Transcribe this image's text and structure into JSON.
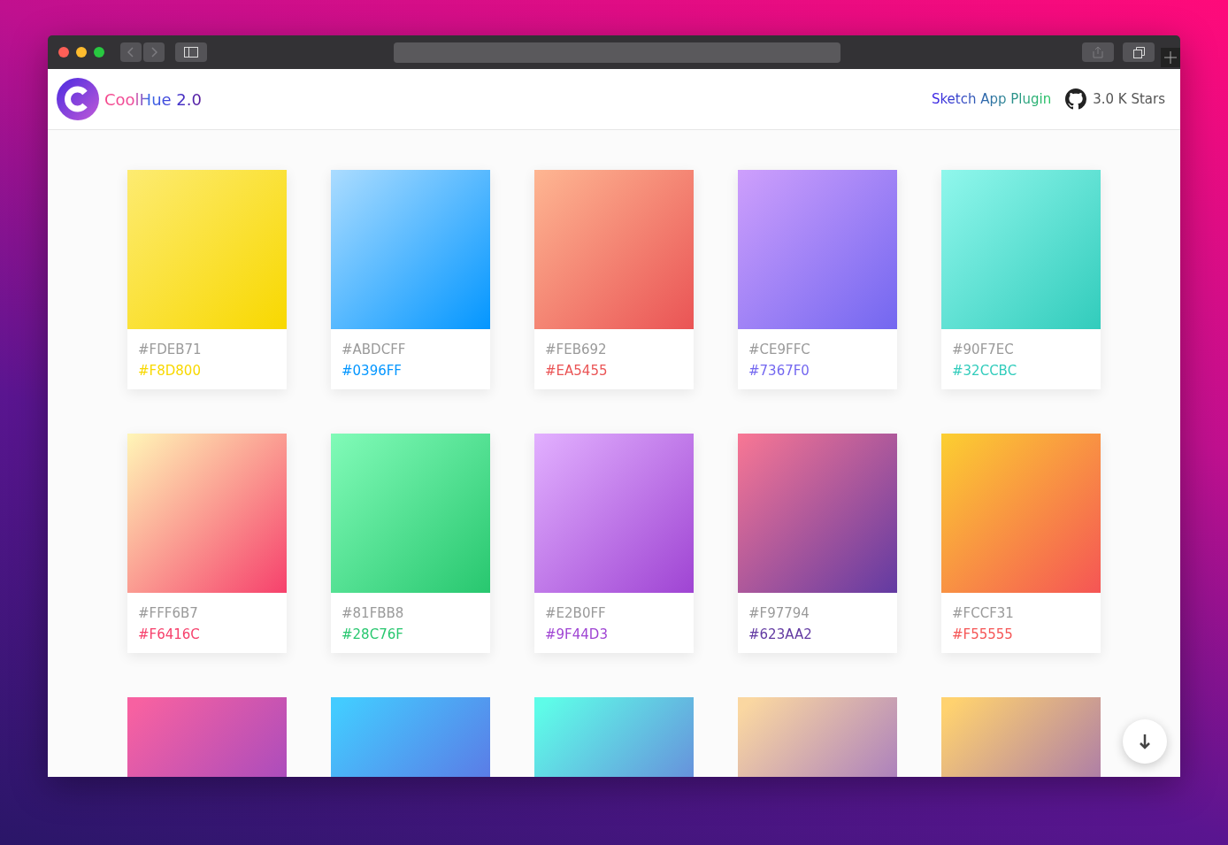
{
  "header": {
    "title": "CoolHue 2.0",
    "links": [
      {
        "kind": "plugin",
        "label": "Sketch App Plugin"
      },
      {
        "kind": "github",
        "label": "3.0 K Stars"
      }
    ]
  },
  "cards": [
    {
      "kind": "full",
      "start": "#FDEB71",
      "end": "#F8D800"
    },
    {
      "kind": "full",
      "start": "#ABDCFF",
      "end": "#0396FF"
    },
    {
      "kind": "full",
      "start": "#FEB692",
      "end": "#EA5455"
    },
    {
      "kind": "full",
      "start": "#CE9FFC",
      "end": "#7367F0"
    },
    {
      "kind": "full",
      "start": "#90F7EC",
      "end": "#32CCBC"
    },
    {
      "kind": "full",
      "start": "#FFF6B7",
      "end": "#F6416C"
    },
    {
      "kind": "full",
      "start": "#81FBB8",
      "end": "#28C76F"
    },
    {
      "kind": "full",
      "start": "#E2B0FF",
      "end": "#9F44D3"
    },
    {
      "kind": "full",
      "start": "#F97794",
      "end": "#623AA2"
    },
    {
      "kind": "full",
      "start": "#FCCF31",
      "end": "#F55555"
    },
    {
      "kind": "partial",
      "color": "#F761A1"
    },
    {
      "kind": "partial",
      "color": "#43CBFF"
    },
    {
      "kind": "partial",
      "color": "#5EFCE8"
    },
    {
      "kind": "partial",
      "color": "#FAD7A1"
    },
    {
      "kind": "partial",
      "color": "#FFD26F"
    }
  ]
}
